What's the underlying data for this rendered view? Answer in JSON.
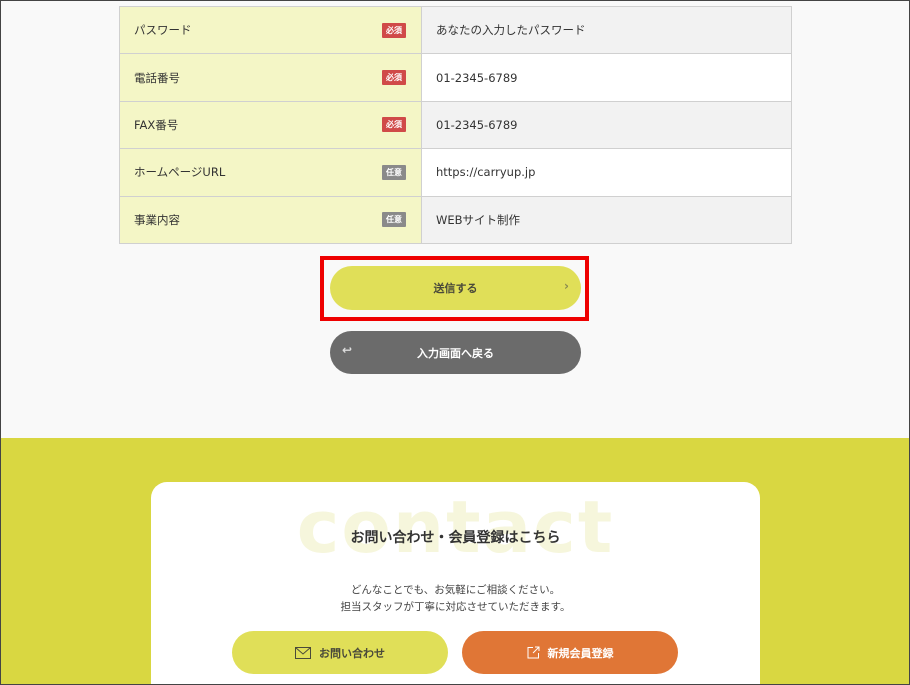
{
  "form_rows": [
    {
      "label": "パスワード",
      "badge": "必須",
      "badge_type": "required",
      "value": "あなたの入力したパスワード"
    },
    {
      "label": "電話番号",
      "badge": "必須",
      "badge_type": "required",
      "value": "01-2345-6789"
    },
    {
      "label": "FAX番号",
      "badge": "必須",
      "badge_type": "required",
      "value": "01-2345-6789"
    },
    {
      "label": "ホームページURL",
      "badge": "任意",
      "badge_type": "optional",
      "value": "https://carryup.jp"
    },
    {
      "label": "事業内容",
      "badge": "任意",
      "badge_type": "optional",
      "value": "WEBサイト制作"
    }
  ],
  "actions": {
    "submit_label": "送信する",
    "submit_icon": "chevron-right-icon",
    "back_label": "入力画面へ戻る",
    "back_icon": "return-arrow-icon"
  },
  "contact": {
    "bg_word": "contact",
    "title": "お問い合わせ・会員登録はこちら",
    "line1": "どんなことでも、お気軽にご相談ください。",
    "line2": "担当スタッフが丁寧に対応させていただきます。",
    "inquiry_label": "お問い合わせ",
    "inquiry_icon": "envelope-icon",
    "register_label": "新規会員登録",
    "register_icon": "external-edit-icon"
  },
  "colors": {
    "accent_yellow": "#e0df58",
    "section_yellow": "#d9d741",
    "label_bg": "#f4f6c6",
    "required_red": "#d04a48",
    "optional_gray": "#8a8a8a",
    "back_gray": "#6b6b6b",
    "register_orange": "#e07636",
    "highlight_red": "#ee0000"
  }
}
